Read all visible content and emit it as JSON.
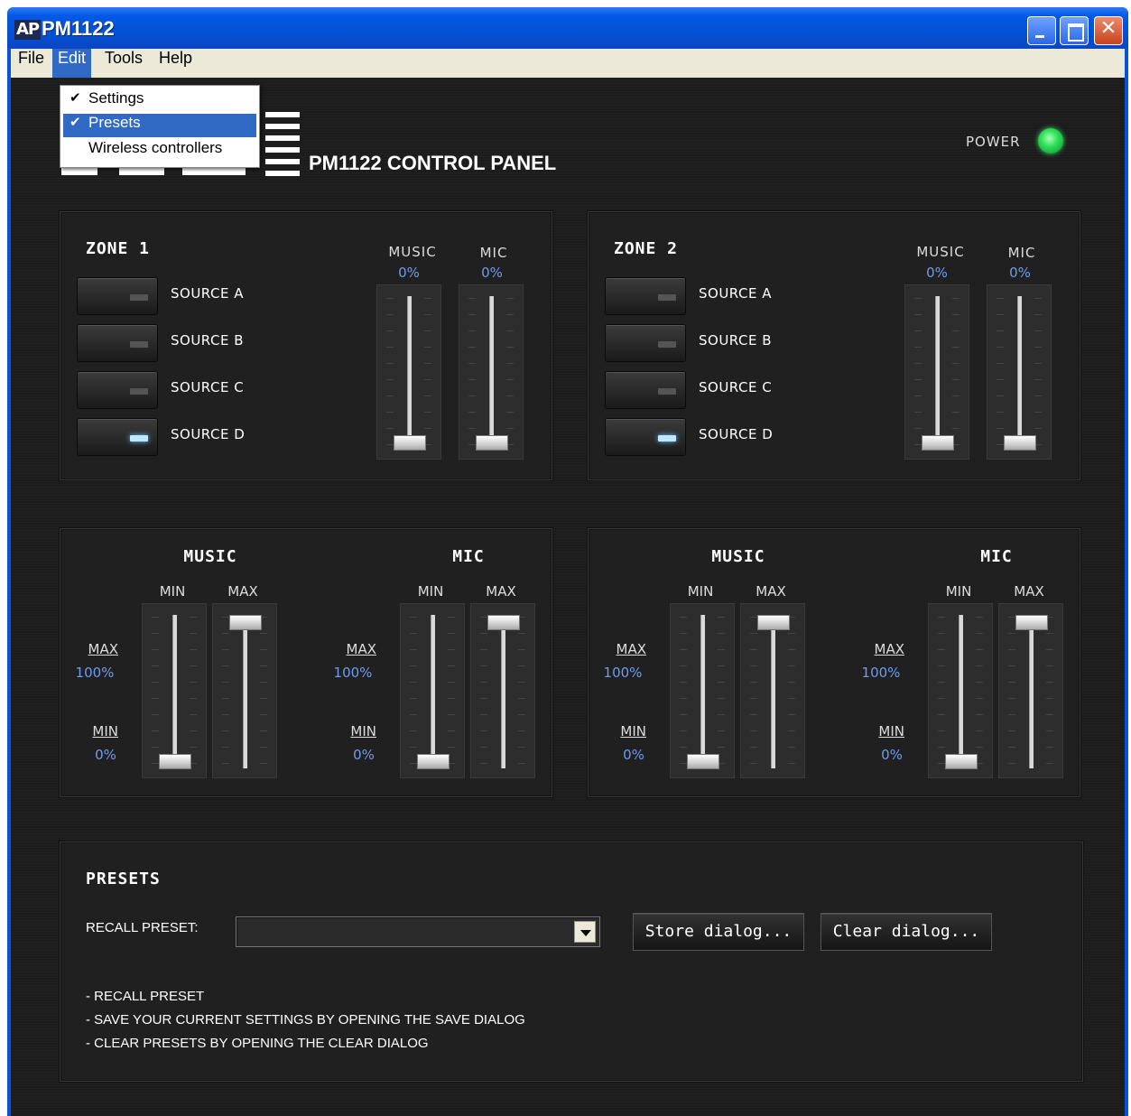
{
  "window": {
    "app_icon": "AP",
    "title": "PM1122",
    "close_glyph": "✕"
  },
  "menu": {
    "file": "File",
    "edit": "Edit",
    "tools": "Tools",
    "help": "Help"
  },
  "edit_menu": {
    "items": [
      {
        "label": "Settings",
        "checked": true,
        "check": "✔"
      },
      {
        "label": "Presets",
        "checked": true,
        "check": "✔",
        "highlighted": true
      },
      {
        "label": "Wireless controllers",
        "checked": false
      }
    ]
  },
  "header": {
    "panel_title": "PM1122 CONTROL PANEL",
    "power_label": "POWER",
    "power_led_color": "#2fe158"
  },
  "zones": [
    {
      "title": "ZONE 1",
      "sources": [
        {
          "label": "SOURCE A",
          "active": false
        },
        {
          "label": "SOURCE B",
          "active": false
        },
        {
          "label": "SOURCE C",
          "active": false
        },
        {
          "label": "SOURCE D",
          "active": true
        }
      ],
      "music": {
        "label": "MUSIC",
        "value": "0%"
      },
      "mic": {
        "label": "MIC",
        "value": "0%"
      }
    },
    {
      "title": "ZONE 2",
      "sources": [
        {
          "label": "SOURCE A",
          "active": false
        },
        {
          "label": "SOURCE B",
          "active": false
        },
        {
          "label": "SOURCE C",
          "active": false
        },
        {
          "label": "SOURCE D",
          "active": true
        }
      ],
      "music": {
        "label": "MUSIC",
        "value": "0%"
      },
      "mic": {
        "label": "MIC",
        "value": "0%"
      }
    }
  ],
  "limits": [
    {
      "music": {
        "title": "MUSIC",
        "min_label": "MIN",
        "max_label": "MAX",
        "max_link": "MAX",
        "max_value": "100%",
        "min_link": "MIN",
        "min_value": "0%"
      },
      "mic": {
        "title": "MIC",
        "min_label": "MIN",
        "max_label": "MAX",
        "max_link": "MAX",
        "max_value": "100%",
        "min_link": "MIN",
        "min_value": "0%"
      }
    },
    {
      "music": {
        "title": "MUSIC",
        "min_label": "MIN",
        "max_label": "MAX",
        "max_link": "MAX",
        "max_value": "100%",
        "min_link": "MIN",
        "min_value": "0%"
      },
      "mic": {
        "title": "MIC",
        "min_label": "MIN",
        "max_label": "MAX",
        "max_link": "MAX",
        "max_value": "100%",
        "min_link": "MIN",
        "min_value": "0%"
      }
    }
  ],
  "presets": {
    "title": "PRESETS",
    "recall_label": "RECALL PRESET:",
    "recall_value": "",
    "store_button": "Store dialog...",
    "clear_button": "Clear dialog...",
    "help": [
      "- RECALL PRESET",
      "- SAVE YOUR CURRENT SETTINGS BY OPENING THE SAVE DIALOG",
      "- CLEAR PRESETS BY OPENING THE CLEAR DIALOG"
    ]
  }
}
